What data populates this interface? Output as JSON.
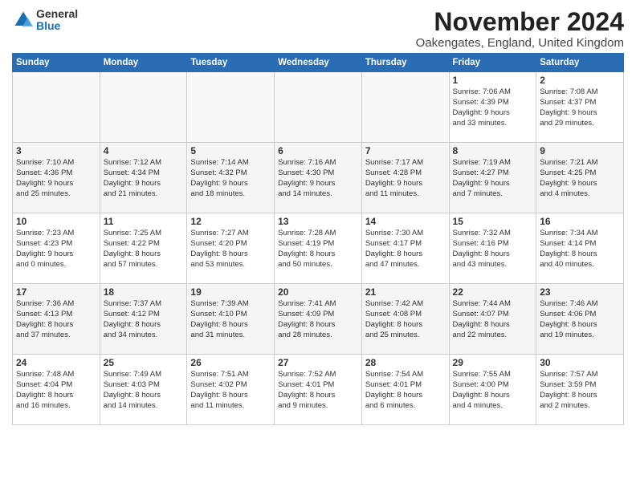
{
  "header": {
    "logo_general": "General",
    "logo_blue": "Blue",
    "month_title": "November 2024",
    "location": "Oakengates, England, United Kingdom"
  },
  "days_of_week": [
    "Sunday",
    "Monday",
    "Tuesday",
    "Wednesday",
    "Thursday",
    "Friday",
    "Saturday"
  ],
  "weeks": [
    [
      {
        "day": "",
        "info": "",
        "empty": true
      },
      {
        "day": "",
        "info": "",
        "empty": true
      },
      {
        "day": "",
        "info": "",
        "empty": true
      },
      {
        "day": "",
        "info": "",
        "empty": true
      },
      {
        "day": "",
        "info": "",
        "empty": true
      },
      {
        "day": "1",
        "info": "Sunrise: 7:06 AM\nSunset: 4:39 PM\nDaylight: 9 hours\nand 33 minutes.",
        "empty": false
      },
      {
        "day": "2",
        "info": "Sunrise: 7:08 AM\nSunset: 4:37 PM\nDaylight: 9 hours\nand 29 minutes.",
        "empty": false
      }
    ],
    [
      {
        "day": "3",
        "info": "Sunrise: 7:10 AM\nSunset: 4:36 PM\nDaylight: 9 hours\nand 25 minutes.",
        "empty": false
      },
      {
        "day": "4",
        "info": "Sunrise: 7:12 AM\nSunset: 4:34 PM\nDaylight: 9 hours\nand 21 minutes.",
        "empty": false
      },
      {
        "day": "5",
        "info": "Sunrise: 7:14 AM\nSunset: 4:32 PM\nDaylight: 9 hours\nand 18 minutes.",
        "empty": false
      },
      {
        "day": "6",
        "info": "Sunrise: 7:16 AM\nSunset: 4:30 PM\nDaylight: 9 hours\nand 14 minutes.",
        "empty": false
      },
      {
        "day": "7",
        "info": "Sunrise: 7:17 AM\nSunset: 4:28 PM\nDaylight: 9 hours\nand 11 minutes.",
        "empty": false
      },
      {
        "day": "8",
        "info": "Sunrise: 7:19 AM\nSunset: 4:27 PM\nDaylight: 9 hours\nand 7 minutes.",
        "empty": false
      },
      {
        "day": "9",
        "info": "Sunrise: 7:21 AM\nSunset: 4:25 PM\nDaylight: 9 hours\nand 4 minutes.",
        "empty": false
      }
    ],
    [
      {
        "day": "10",
        "info": "Sunrise: 7:23 AM\nSunset: 4:23 PM\nDaylight: 9 hours\nand 0 minutes.",
        "empty": false
      },
      {
        "day": "11",
        "info": "Sunrise: 7:25 AM\nSunset: 4:22 PM\nDaylight: 8 hours\nand 57 minutes.",
        "empty": false
      },
      {
        "day": "12",
        "info": "Sunrise: 7:27 AM\nSunset: 4:20 PM\nDaylight: 8 hours\nand 53 minutes.",
        "empty": false
      },
      {
        "day": "13",
        "info": "Sunrise: 7:28 AM\nSunset: 4:19 PM\nDaylight: 8 hours\nand 50 minutes.",
        "empty": false
      },
      {
        "day": "14",
        "info": "Sunrise: 7:30 AM\nSunset: 4:17 PM\nDaylight: 8 hours\nand 47 minutes.",
        "empty": false
      },
      {
        "day": "15",
        "info": "Sunrise: 7:32 AM\nSunset: 4:16 PM\nDaylight: 8 hours\nand 43 minutes.",
        "empty": false
      },
      {
        "day": "16",
        "info": "Sunrise: 7:34 AM\nSunset: 4:14 PM\nDaylight: 8 hours\nand 40 minutes.",
        "empty": false
      }
    ],
    [
      {
        "day": "17",
        "info": "Sunrise: 7:36 AM\nSunset: 4:13 PM\nDaylight: 8 hours\nand 37 minutes.",
        "empty": false
      },
      {
        "day": "18",
        "info": "Sunrise: 7:37 AM\nSunset: 4:12 PM\nDaylight: 8 hours\nand 34 minutes.",
        "empty": false
      },
      {
        "day": "19",
        "info": "Sunrise: 7:39 AM\nSunset: 4:10 PM\nDaylight: 8 hours\nand 31 minutes.",
        "empty": false
      },
      {
        "day": "20",
        "info": "Sunrise: 7:41 AM\nSunset: 4:09 PM\nDaylight: 8 hours\nand 28 minutes.",
        "empty": false
      },
      {
        "day": "21",
        "info": "Sunrise: 7:42 AM\nSunset: 4:08 PM\nDaylight: 8 hours\nand 25 minutes.",
        "empty": false
      },
      {
        "day": "22",
        "info": "Sunrise: 7:44 AM\nSunset: 4:07 PM\nDaylight: 8 hours\nand 22 minutes.",
        "empty": false
      },
      {
        "day": "23",
        "info": "Sunrise: 7:46 AM\nSunset: 4:06 PM\nDaylight: 8 hours\nand 19 minutes.",
        "empty": false
      }
    ],
    [
      {
        "day": "24",
        "info": "Sunrise: 7:48 AM\nSunset: 4:04 PM\nDaylight: 8 hours\nand 16 minutes.",
        "empty": false
      },
      {
        "day": "25",
        "info": "Sunrise: 7:49 AM\nSunset: 4:03 PM\nDaylight: 8 hours\nand 14 minutes.",
        "empty": false
      },
      {
        "day": "26",
        "info": "Sunrise: 7:51 AM\nSunset: 4:02 PM\nDaylight: 8 hours\nand 11 minutes.",
        "empty": false
      },
      {
        "day": "27",
        "info": "Sunrise: 7:52 AM\nSunset: 4:01 PM\nDaylight: 8 hours\nand 9 minutes.",
        "empty": false
      },
      {
        "day": "28",
        "info": "Sunrise: 7:54 AM\nSunset: 4:01 PM\nDaylight: 8 hours\nand 6 minutes.",
        "empty": false
      },
      {
        "day": "29",
        "info": "Sunrise: 7:55 AM\nSunset: 4:00 PM\nDaylight: 8 hours\nand 4 minutes.",
        "empty": false
      },
      {
        "day": "30",
        "info": "Sunrise: 7:57 AM\nSunset: 3:59 PM\nDaylight: 8 hours\nand 2 minutes.",
        "empty": false
      }
    ]
  ]
}
